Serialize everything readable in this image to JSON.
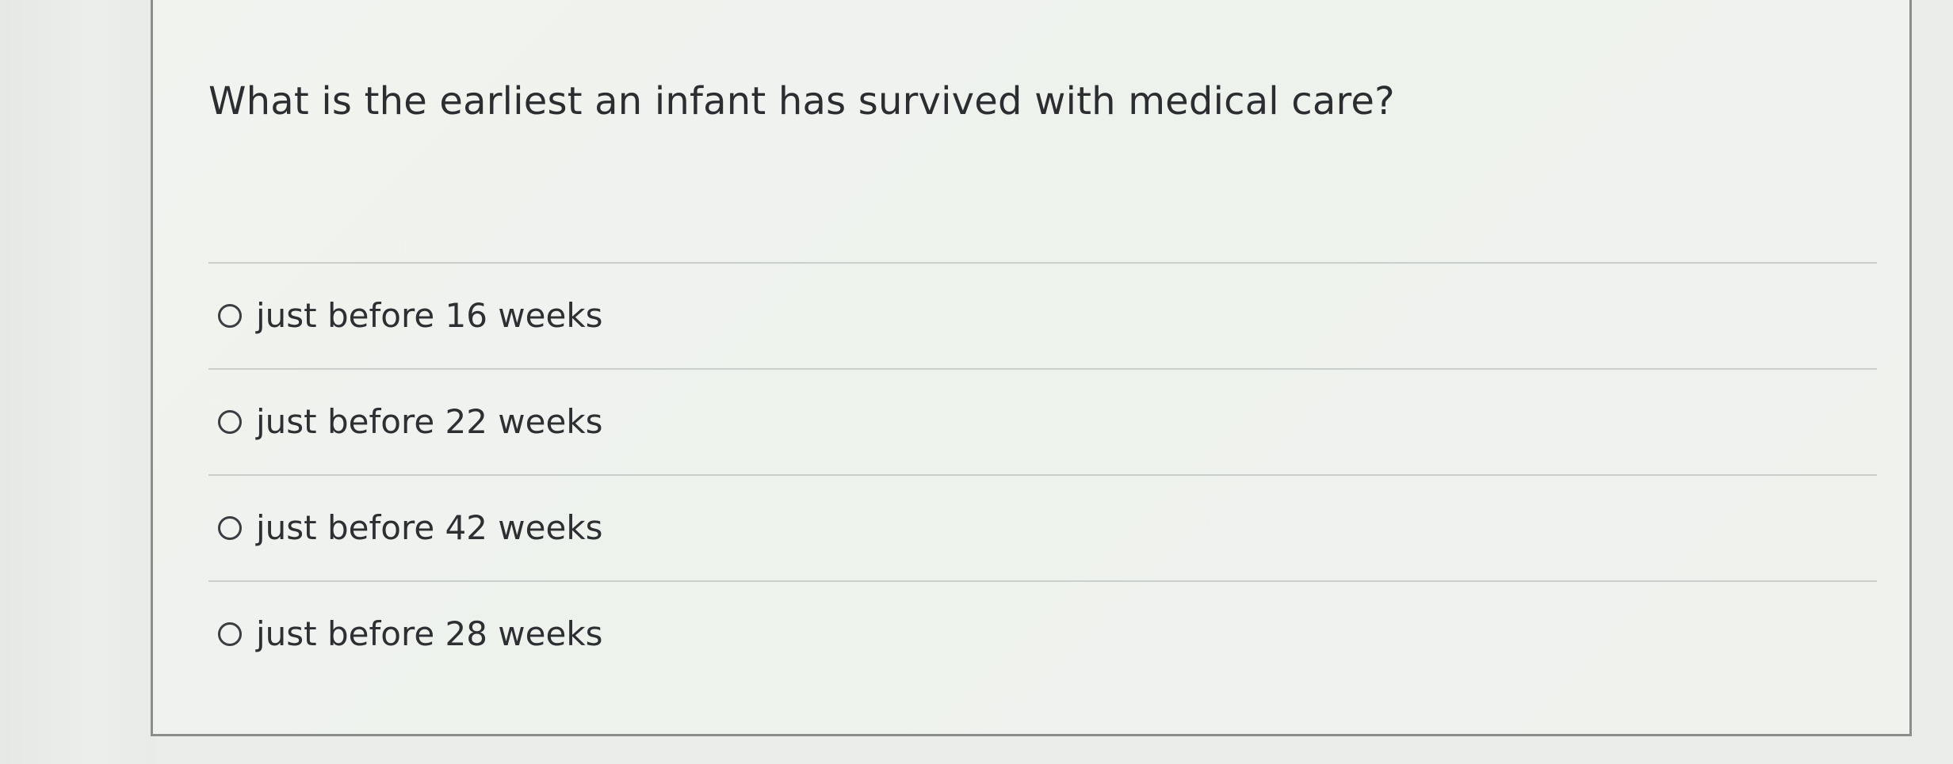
{
  "question": {
    "text": "What is the earliest an infant has survived with medical care?"
  },
  "options": [
    {
      "label": "just before 16 weeks",
      "selected": false
    },
    {
      "label": "just before 22 weeks",
      "selected": false
    },
    {
      "label": "just before 42 weeks",
      "selected": false
    },
    {
      "label": "just before 28 weeks",
      "selected": false
    }
  ]
}
